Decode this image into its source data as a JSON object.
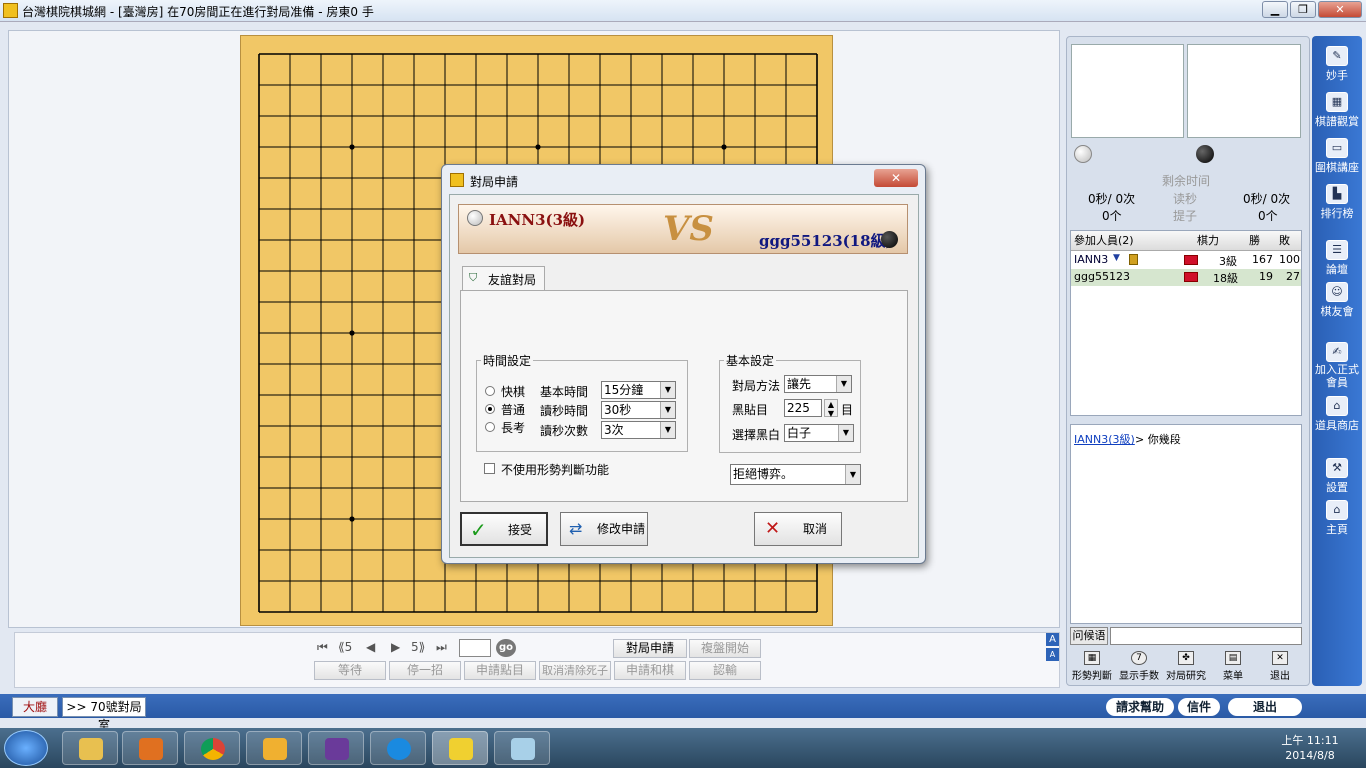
{
  "window": {
    "title": "台灣棋院棋城網 - [臺灣房]  在70房間正在進行對局准備 - 房東0 手",
    "min": "▁",
    "max": "❐",
    "close": "✕"
  },
  "board": {
    "size": 19,
    "star_points": [
      [
        3,
        3
      ],
      [
        9,
        3
      ],
      [
        15,
        3
      ],
      [
        3,
        9
      ],
      [
        3,
        15
      ]
    ]
  },
  "nav": {
    "first": "⏮",
    "back5": "⟪5",
    "back": "◀",
    "fwd": "▶",
    "fwd5": "5⟫",
    "last": "⏭",
    "go": "go",
    "move_value": ""
  },
  "game_buttons": {
    "apply": "對局申請",
    "review": "複盤開始",
    "wait": "等待",
    "pass": "停一招",
    "apply_count": "申請點目",
    "cancel_dead": "取消清除死子",
    "apply_draw": "申請和棋",
    "resign": "認輸"
  },
  "font_toggle": {
    "a1": "A",
    "a2": "A"
  },
  "right_panel": {
    "remaining_label": "剩余时间",
    "byoyomi_label": "读秒",
    "captures_label": "提子",
    "white_time": "0秒/ 0次",
    "black_time": "0秒/ 0次",
    "white_caps": "0个",
    "black_caps": "0个",
    "players_header": {
      "name": "參加人員(2)",
      "rank": "棋力",
      "win": "勝",
      "loss": "敗"
    },
    "players": [
      {
        "name": "IANN3",
        "rank": "3級",
        "win": "167",
        "loss": "100",
        "flag_color": "#d0102a"
      },
      {
        "name": "ggg55123",
        "rank": "18級",
        "win": "19",
        "loss": "27",
        "flag_color": "#d0102a"
      }
    ],
    "chat": {
      "sender": "IANN3(3級)",
      "message": "> 你幾段"
    },
    "chat_input_label": "问候语",
    "tools": [
      "形勢判斷",
      "显示手数",
      "对局研究",
      "菜单",
      "退出"
    ]
  },
  "sidebar": [
    "妙手",
    "棋譜觀賞",
    "圍棋講座",
    "排行榜",
    "論壇",
    "棋友會",
    "加入正式會員",
    "道具商店",
    "設置",
    "主頁"
  ],
  "bottom_tabs": {
    "lobby": "大廳",
    "room": ">> 70號對局室",
    "help": "請求幫助",
    "mail": "信件",
    "exit": "退出"
  },
  "dialog": {
    "title": "對局申請",
    "player_white": "IANN3(3級)",
    "vs": "VS",
    "player_black": "ggg55123(18級)",
    "tab": "友誼對局",
    "time_legend": "時間設定",
    "modes": [
      "快棋",
      "普通",
      "長考"
    ],
    "selected_mode": 1,
    "time_labels": [
      "基本時間",
      "讀秒時間",
      "讀秒次數"
    ],
    "time_values": [
      "15分鐘",
      "30秒",
      "3次"
    ],
    "basic_legend": "基本設定",
    "method_label": "對局方法",
    "method_value": "讓先",
    "komi_label": "黑貼目",
    "komi_value": "225",
    "komi_unit": "目",
    "color_label": "選擇黑白",
    "color_value": "白子",
    "no_judge_label": "不使用形勢判斷功能",
    "observe_value": "拒絕博弈。",
    "accept": "接受",
    "modify": "修改申請",
    "cancel": "取消"
  },
  "taskbar": {
    "time": "上午 11:11",
    "date": "2014/8/8"
  }
}
